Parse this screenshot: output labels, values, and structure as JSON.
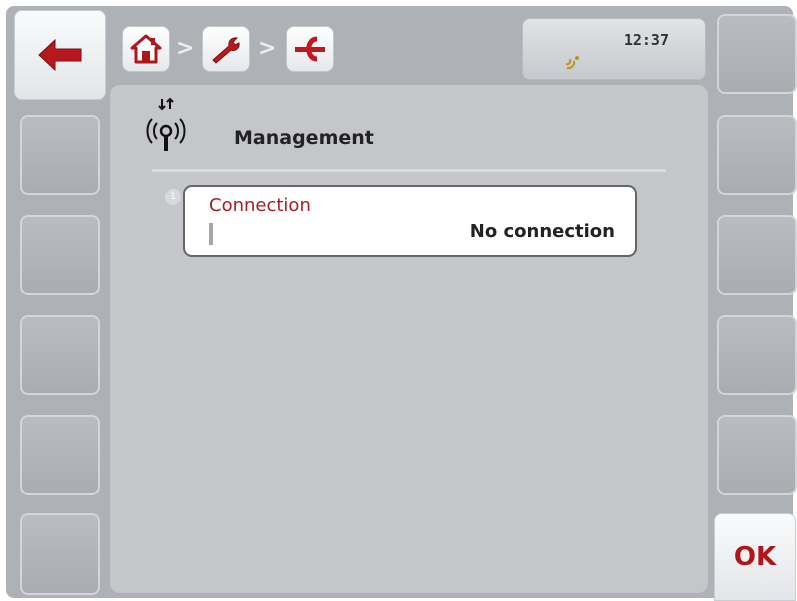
{
  "navigation": {
    "back_icon": "arrow-left-icon",
    "breadcrumbs": [
      {
        "icon": "home-icon"
      },
      {
        "icon": "wrench-icon"
      },
      {
        "icon": "connector-icon"
      }
    ],
    "separator": ">"
  },
  "status": {
    "time": "12:37",
    "icon": "satellite-signal-icon"
  },
  "page": {
    "title": "Management",
    "title_icon": "wireless-transfer-icon"
  },
  "fields": [
    {
      "index": "1",
      "label": "Connection",
      "value": "No connection"
    }
  ],
  "softkeys": {
    "ok_label": "OK"
  },
  "colors": {
    "accent": "#b0151a",
    "label": "#a31f24",
    "background": "#aeb1b6",
    "panel": "#c4c6ca"
  }
}
